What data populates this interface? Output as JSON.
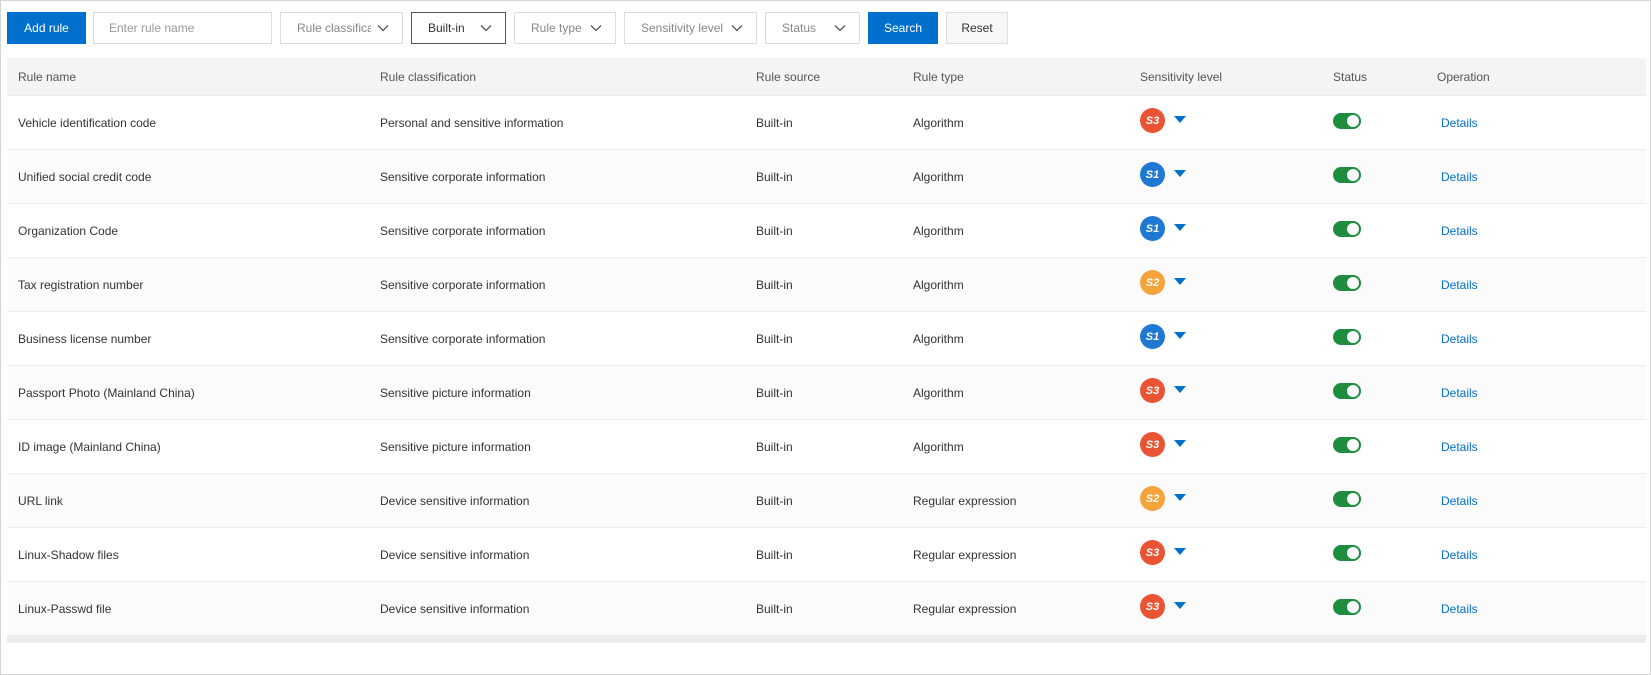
{
  "toolbar": {
    "add_rule": "Add rule",
    "rule_name_placeholder": "Enter rule name",
    "filters": [
      {
        "label": "Rule classificat",
        "active": false
      },
      {
        "label": "Built-in",
        "active": true
      },
      {
        "label": "Rule type",
        "active": false
      },
      {
        "label": "Sensitivity level",
        "active": false
      },
      {
        "label": "Status",
        "active": false
      }
    ],
    "search": "Search",
    "reset": "Reset"
  },
  "table": {
    "headers": [
      "Rule name",
      "Rule classification",
      "Rule source",
      "Rule type",
      "Sensitivity level",
      "Status",
      "Operation"
    ],
    "rows": [
      {
        "name": "Vehicle identification code",
        "classification": "Personal and sensitive information",
        "source": "Built-in",
        "type": "Algorithm",
        "level": "S3",
        "status": "on",
        "operation": "Details"
      },
      {
        "name": "Unified social credit code",
        "classification": "Sensitive corporate information",
        "source": "Built-in",
        "type": "Algorithm",
        "level": "S1",
        "status": "on",
        "operation": "Details"
      },
      {
        "name": "Organization Code",
        "classification": "Sensitive corporate information",
        "source": "Built-in",
        "type": "Algorithm",
        "level": "S1",
        "status": "on",
        "operation": "Details"
      },
      {
        "name": "Tax registration number",
        "classification": "Sensitive corporate information",
        "source": "Built-in",
        "type": "Algorithm",
        "level": "S2",
        "status": "on",
        "operation": "Details"
      },
      {
        "name": "Business license number",
        "classification": "Sensitive corporate information",
        "source": "Built-in",
        "type": "Algorithm",
        "level": "S1",
        "status": "on",
        "operation": "Details"
      },
      {
        "name": "Passport Photo (Mainland China)",
        "classification": "Sensitive picture information",
        "source": "Built-in",
        "type": "Algorithm",
        "level": "S3",
        "status": "on",
        "operation": "Details"
      },
      {
        "name": "ID image (Mainland China)",
        "classification": "Sensitive picture information",
        "source": "Built-in",
        "type": "Algorithm",
        "level": "S3",
        "status": "on",
        "operation": "Details"
      },
      {
        "name": "URL link",
        "classification": "Device sensitive information",
        "source": "Built-in",
        "type": "Regular expression",
        "level": "S2",
        "status": "on",
        "operation": "Details"
      },
      {
        "name": "Linux-Shadow files",
        "classification": "Device sensitive information",
        "source": "Built-in",
        "type": "Regular expression",
        "level": "S3",
        "status": "on",
        "operation": "Details"
      },
      {
        "name": "Linux-Passwd file",
        "classification": "Device sensitive information",
        "source": "Built-in",
        "type": "Regular expression",
        "level": "S3",
        "status": "on",
        "operation": "Details"
      }
    ]
  },
  "level_colors": {
    "S1": "#1f78d1",
    "S2": "#f5a33b",
    "S3": "#ea5334"
  },
  "colors": {
    "primary": "#0070cc",
    "toggle_on": "#1e8e3e"
  }
}
